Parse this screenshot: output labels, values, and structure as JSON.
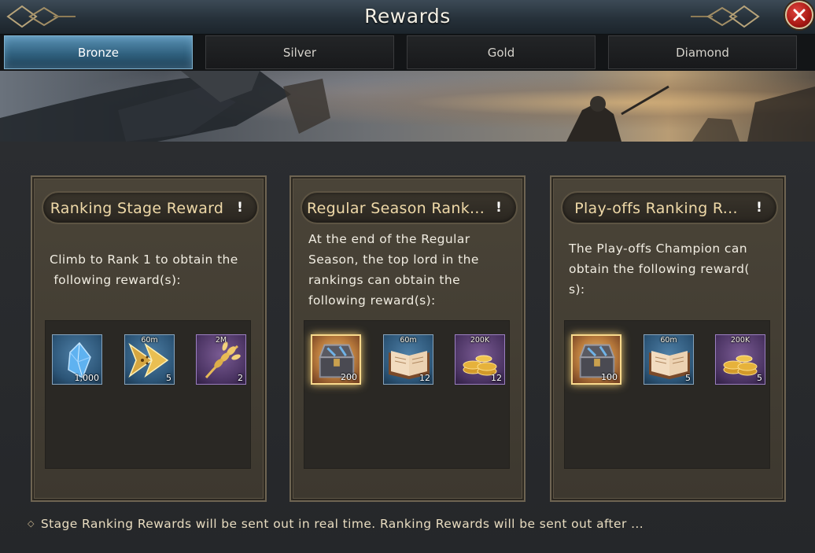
{
  "window": {
    "title": "Rewards"
  },
  "tabs": [
    {
      "label": "Bronze",
      "active": true
    },
    {
      "label": "Silver",
      "active": false
    },
    {
      "label": "Gold",
      "active": false
    },
    {
      "label": "Diamond",
      "active": false
    }
  ],
  "cards": [
    {
      "title": "Ranking Stage Reward",
      "info": "!",
      "description": [
        "Climb to Rank 1 to obtain the",
        " following reward(s):"
      ],
      "rewards": [
        {
          "icon": "blue-crystal-icon",
          "tag": "",
          "qty": "1,000"
        },
        {
          "icon": "speedup-arrows-icon",
          "tag": "60m",
          "qty": "5"
        },
        {
          "icon": "wheat-bundle-icon",
          "tag": "2M",
          "qty": "2"
        }
      ]
    },
    {
      "title": "Regular Season Rank...",
      "info": "!",
      "description": [
        "At the end of the Regular",
        "Season, the top lord in the",
        "rankings can obtain the",
        "following reward(s):"
      ],
      "rewards": [
        {
          "icon": "treasure-chest-icon",
          "tag": "",
          "qty": "200"
        },
        {
          "icon": "open-book-icon",
          "tag": "60m",
          "qty": "12"
        },
        {
          "icon": "gold-coins-icon",
          "tag": "200K",
          "qty": "12"
        }
      ]
    },
    {
      "title": "Play-offs Ranking R...",
      "info": "!",
      "description": [
        "The Play-offs Champion can",
        "obtain the following reward(",
        "s):"
      ],
      "rewards": [
        {
          "icon": "treasure-chest-icon",
          "tag": "",
          "qty": "100"
        },
        {
          "icon": "open-book-icon",
          "tag": "60m",
          "qty": "5"
        },
        {
          "icon": "gold-coins-icon",
          "tag": "200K",
          "qty": "5"
        }
      ]
    }
  ],
  "footer": {
    "note": "Stage Ranking Rewards will be sent out in real time. Ranking Rewards will be sent out after ..."
  },
  "colors": {
    "accent": "#30617f",
    "card_title": "#efd9a8",
    "close": "#a81914"
  }
}
